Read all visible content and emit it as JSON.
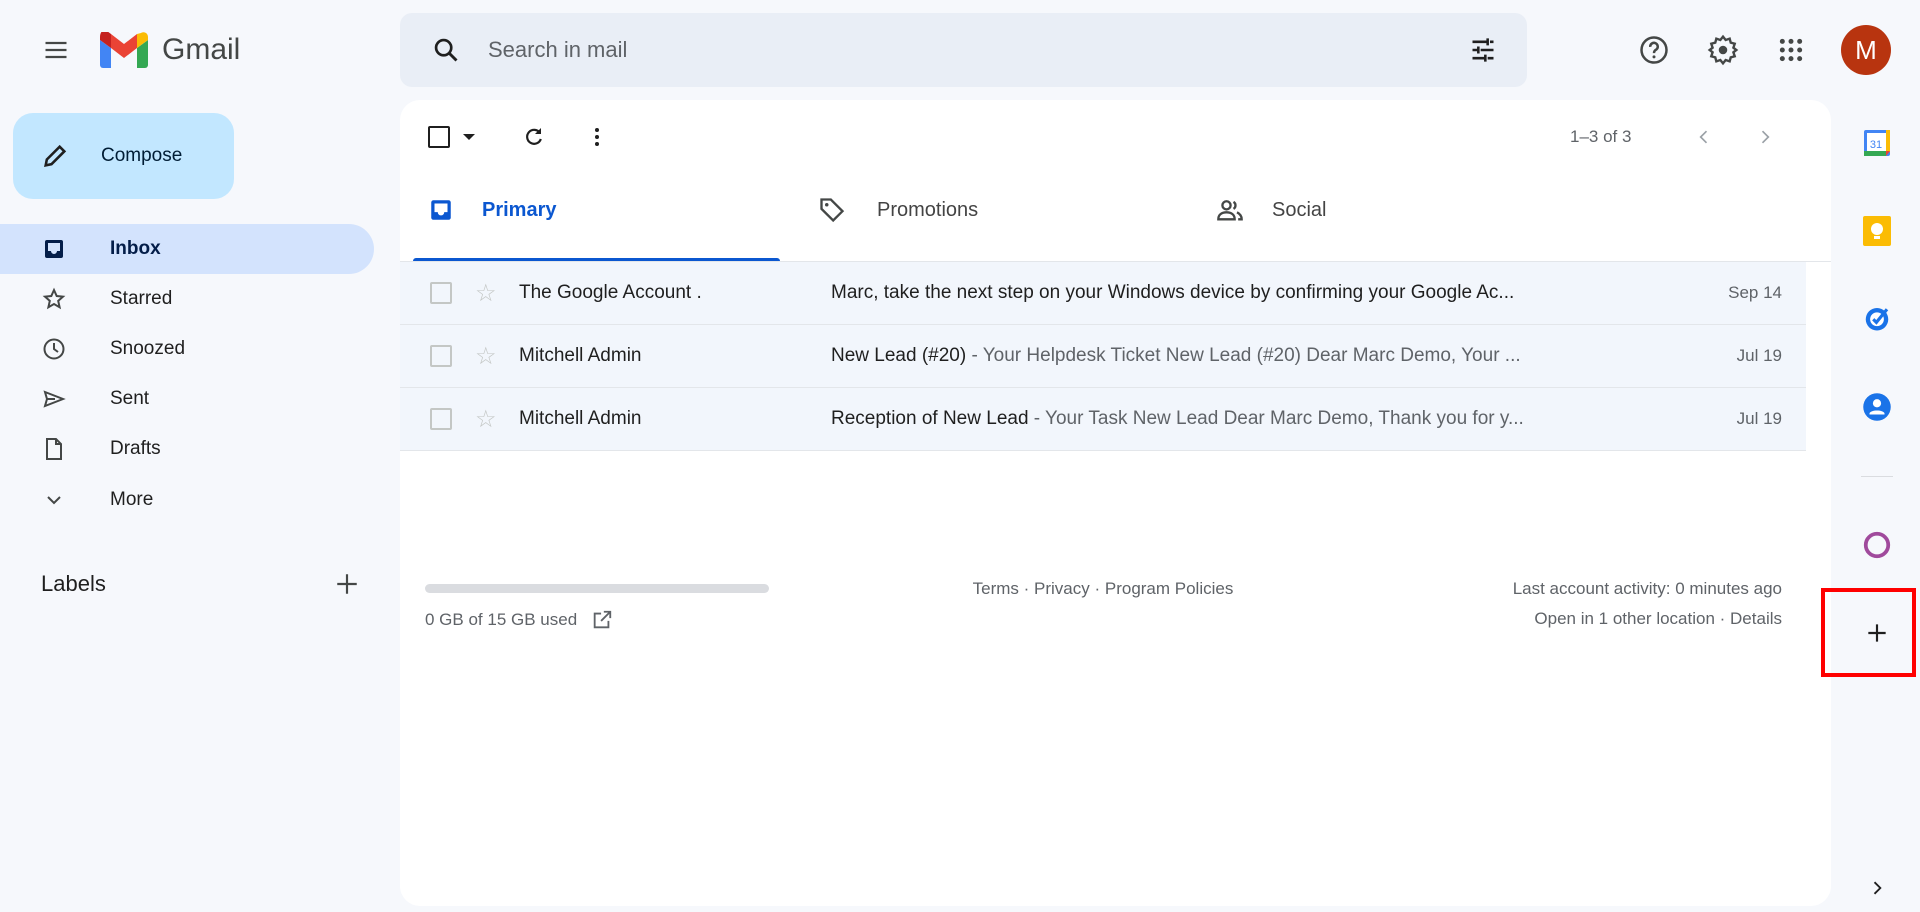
{
  "app": {
    "name": "Gmail"
  },
  "search": {
    "placeholder": "Search in mail"
  },
  "header": {
    "avatar_letter": "M",
    "avatar_color": "#b8340f"
  },
  "compose_label": "Compose",
  "sidebar": {
    "items": [
      {
        "label": "Inbox",
        "icon": "inbox-icon",
        "active": true
      },
      {
        "label": "Starred",
        "icon": "star-icon"
      },
      {
        "label": "Snoozed",
        "icon": "clock-icon"
      },
      {
        "label": "Sent",
        "icon": "send-icon"
      },
      {
        "label": "Drafts",
        "icon": "draft-icon"
      },
      {
        "label": "More",
        "icon": "chevron-down-icon"
      }
    ],
    "labels_heading": "Labels"
  },
  "toolbar": {
    "pagination": "1–3 of 3"
  },
  "tabs": [
    {
      "label": "Primary",
      "active": true
    },
    {
      "label": "Promotions"
    },
    {
      "label": "Social"
    }
  ],
  "emails": [
    {
      "sender": "The Google Account .",
      "subject": "Marc, take the next step on your Windows device by confirming your Google Ac...",
      "snippet": "",
      "date": "Sep 14"
    },
    {
      "sender": "Mitchell Admin",
      "subject": "New Lead (#20)",
      "snippet": " - Your Helpdesk Ticket New Lead (#20) Dear Marc Demo, Your ...",
      "date": "Jul 19"
    },
    {
      "sender": "Mitchell Admin",
      "subject": "Reception of New Lead",
      "snippet": " - Your Task New Lead Dear Marc Demo, Thank you for y...",
      "date": "Jul 19"
    }
  ],
  "footer": {
    "storage": "0 GB of 15 GB used",
    "storage_used_fraction": 0,
    "terms": "Terms",
    "privacy": "Privacy",
    "policies": "Program Policies",
    "sep": " · ",
    "activity": "Last account activity: 0 minutes ago",
    "other_location": "Open in 1 other location",
    "details": "Details"
  },
  "rail": {
    "calendar_day": "31"
  },
  "colors": {
    "accent": "#0b57d0",
    "highlight": "#ff0000"
  }
}
